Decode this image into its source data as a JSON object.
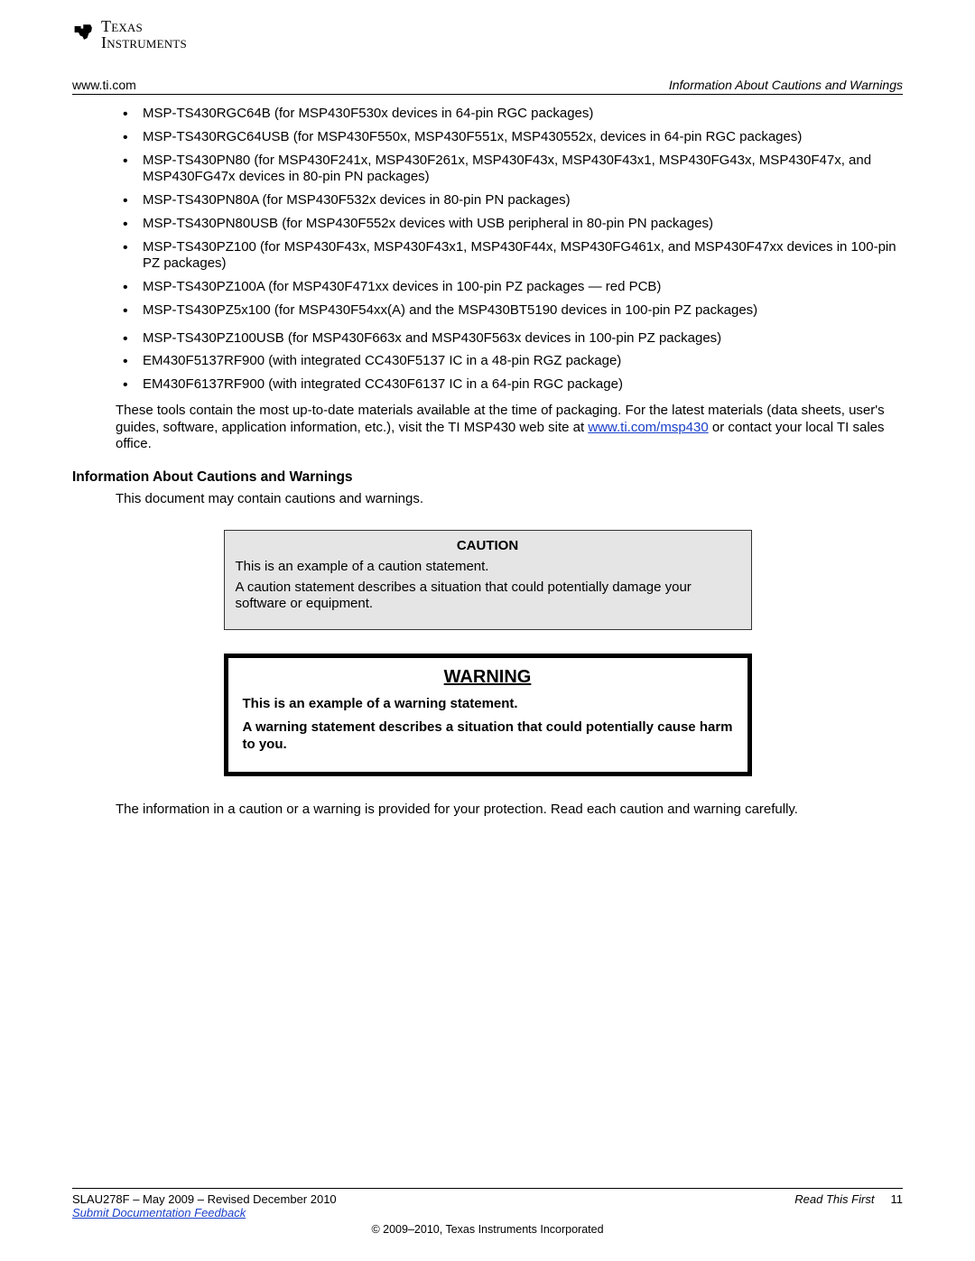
{
  "header": {
    "left_url": "www.ti.com",
    "right_label": "Information About Cautions and Warnings"
  },
  "logo": {
    "line1": "Texas",
    "line2": "Instruments",
    "icon_name": "ti-chip-icon"
  },
  "bullets": [
    "MSP-TS430RGC64B (for MSP430F530x devices in 64-pin RGC packages)",
    "MSP-TS430RGC64USB (for MSP430F550x, MSP430F551x, MSP430552x, devices in 64-pin RGC packages)",
    "MSP-TS430PN80 (for MSP430F241x, MSP430F261x, MSP430F43x, MSP430F43x1, MSP430FG43x, MSP430F47x, and MSP430FG47x devices in 80-pin PN packages)",
    "MSP-TS430PN80A (for MSP430F532x devices in 80-pin PN packages)",
    "MSP-TS430PN80USB (for MSP430F552x devices with USB peripheral in 80-pin PN packages)",
    "MSP-TS430PZ100 (for MSP430F43x, MSP430F43x1, MSP430F44x, MSP430FG461x, and MSP430F47xx devices in 100-pin PZ packages)",
    "MSP-TS430PZ100A (for MSP430F471xx devices in 100-pin PZ packages — red PCB)",
    "MSP-TS430PZ5x100 (for MSP430F54xx(A) and the MSP430BT5190 devices in 100-pin PZ packages)",
    "MSP-TS430PZ100USB (for MSP430F663x and MSP430F563x devices in 100-pin PZ packages)",
    "EM430F5137RF900 (with integrated CC430F5137 IC in a 48-pin RGZ package)",
    "EM430F6137RF900 (with integrated CC430F6137 IC in a 64-pin RGC package)"
  ],
  "para1_pre": "These tools contain the most up-to-date materials available at the time of packaging. For the latest materials (data sheets, user's guides, software, application information, etc.), visit the TI MSP430 web site at ",
  "para1_link_text": "www.ti.com/msp430",
  "para1_post": " or contact your local TI sales office.",
  "section_heading": "Information About Cautions and Warnings",
  "section_intro": "This document may contain cautions and warnings.",
  "caution": {
    "title": "CAUTION",
    "p1": "This is an example of a caution statement.",
    "p2": "A caution statement describes a situation that could potentially damage your software or equipment."
  },
  "warning": {
    "title": "WARNING",
    "p1": "This is an example of a warning statement.",
    "p2": "A warning statement describes a situation that could potentially cause harm to you."
  },
  "outro": "The information in a caution or a warning is provided for your protection. Read each caution and warning carefully.",
  "footer": {
    "doc_id": "SLAU278F – May 2009 – Revised December 2010",
    "feedback_label": "Submit Documentation Feedback",
    "right_italic": "Read This First",
    "page_number": "11",
    "copyright": "© 2009–2010, Texas Instruments Incorporated"
  }
}
